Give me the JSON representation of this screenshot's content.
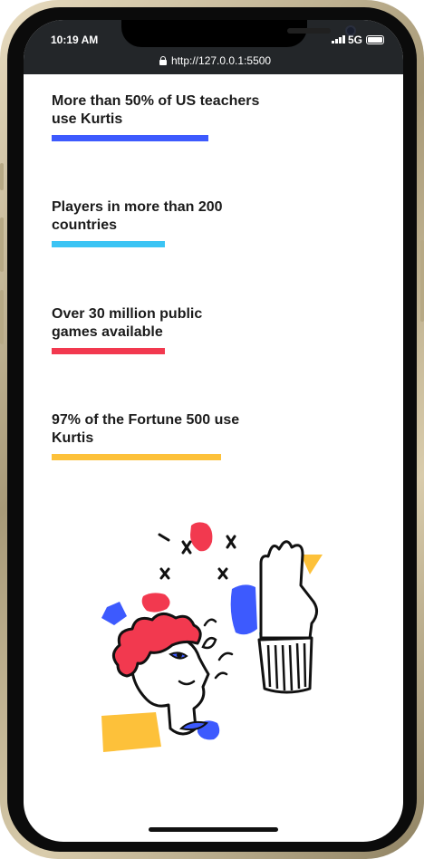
{
  "status_bar": {
    "time": "10:19 AM",
    "network": "5G",
    "url": "http://127.0.0.1:5500"
  },
  "stats": [
    {
      "text": "More than 50% of US teachers use Kurtis",
      "color": "#3d5afe",
      "bar_fraction": 0.72
    },
    {
      "text": "Players in more than 200 countries",
      "color": "#3bc4f4",
      "bar_fraction": 0.52
    },
    {
      "text": "Over 30 million public games available",
      "color": "#f2394f",
      "bar_fraction": 0.52
    },
    {
      "text": "97% of the Fortune 500 use Kurtis",
      "color": "#fdc13a",
      "bar_fraction": 0.78
    }
  ],
  "illustration": {
    "icon": "high-five-illustration",
    "colors": {
      "red": "#f2394f",
      "blue": "#3d5afe",
      "yellow": "#fdc13a",
      "cyan": "#3bc4f4",
      "ink": "#111111"
    }
  }
}
